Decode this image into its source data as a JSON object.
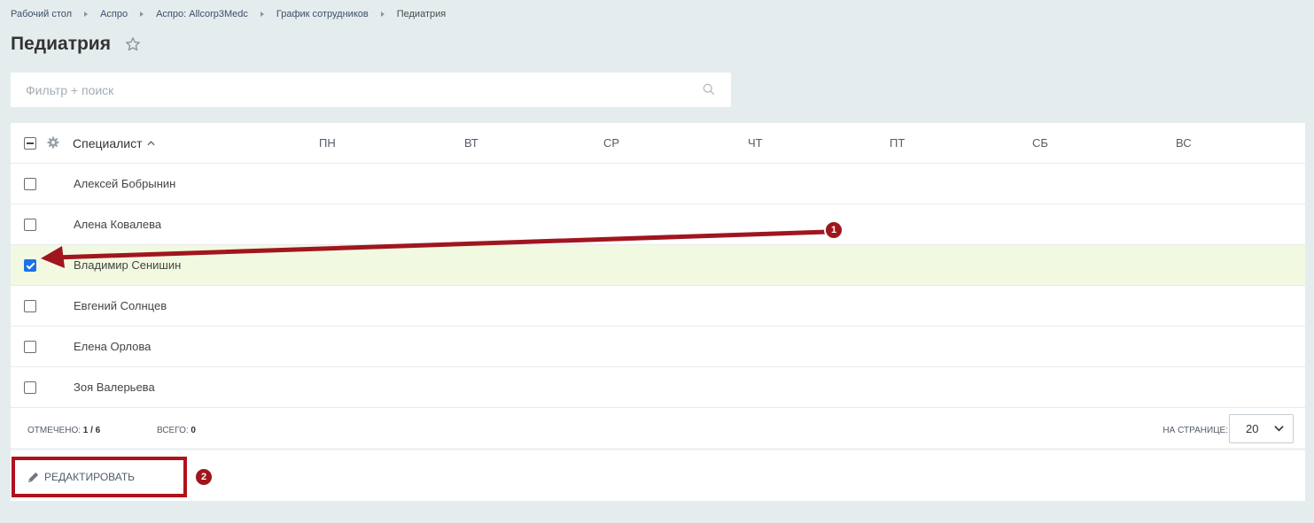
{
  "breadcrumb": [
    "Рабочий стол",
    "Аспро",
    "Аспро: Allcorp3Medc",
    "График сотрудников",
    "Педиатрия"
  ],
  "page": {
    "title": "Педиатрия"
  },
  "search": {
    "placeholder": "Фильтр + поиск"
  },
  "table": {
    "columns": {
      "specialist": "Специалист",
      "days": [
        "ПН",
        "ВТ",
        "СР",
        "ЧТ",
        "ПТ",
        "СБ",
        "ВС"
      ]
    },
    "rows": [
      {
        "name": "Алексей Бобрынин",
        "checked": false
      },
      {
        "name": "Алена Ковалева",
        "checked": false
      },
      {
        "name": "Владимир Сенишин",
        "checked": true
      },
      {
        "name": "Евгений Солнцев",
        "checked": false
      },
      {
        "name": "Елена Орлова",
        "checked": false
      },
      {
        "name": "Зоя Валерьева",
        "checked": false
      }
    ]
  },
  "footer": {
    "marked_label": "ОТМЕЧЕНО:",
    "marked_value": "1 / 6",
    "total_label": "ВСЕГО:",
    "total_value": "0",
    "per_page_label": "НА СТРАНИЦЕ:",
    "per_page_value": "20"
  },
  "actions": {
    "edit_label": "РЕДАКТИРОВАТЬ"
  },
  "annotations": {
    "badge1": "1",
    "badge2": "2"
  },
  "colors": {
    "accent": "#a0161e",
    "checkbox": "#1a73e8",
    "selected_row": "#f2f9e1"
  }
}
